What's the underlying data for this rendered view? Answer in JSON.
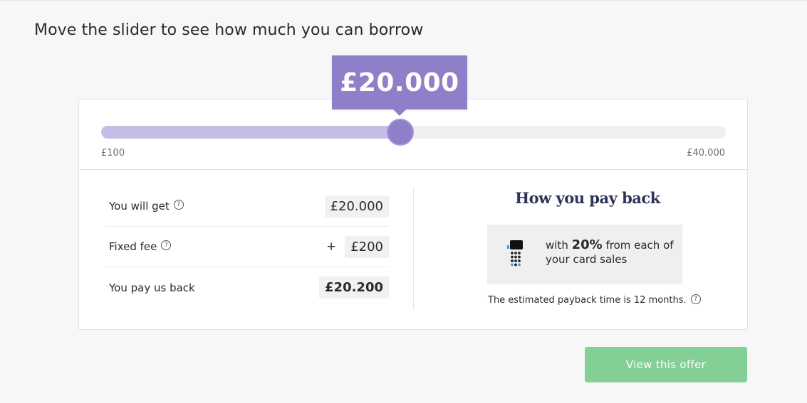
{
  "page": {
    "title": "Move the slider to see how much you can borrow"
  },
  "slider": {
    "selected_amount": "£20.000",
    "min_label": "£100",
    "max_label": "£40.000",
    "fill_fraction": 0.4789,
    "colors": {
      "fill": "#c6bde6",
      "thumb": "#8e7fc8",
      "track": "#efefef"
    }
  },
  "breakdown": {
    "rows": [
      {
        "label": "You will get",
        "has_help": true,
        "prefix": "",
        "value": "£20.000",
        "bold": false
      },
      {
        "label": "Fixed fee",
        "has_help": true,
        "prefix": "+",
        "value": "£200",
        "bold": false
      },
      {
        "label": "You pay us back",
        "has_help": false,
        "prefix": "",
        "value": "£20.200",
        "bold": true
      }
    ],
    "help_icon": "question-circle-icon"
  },
  "payback": {
    "title": "How you pay back",
    "icon": "card-terminal-icon",
    "text_before": "with ",
    "percent": "20%",
    "text_after": " from each of your card sales",
    "note": "The estimated payback time is 12 months.",
    "help_icon": "question-circle-icon"
  },
  "cta": {
    "label": "View this offer",
    "color": "#84cf94"
  }
}
